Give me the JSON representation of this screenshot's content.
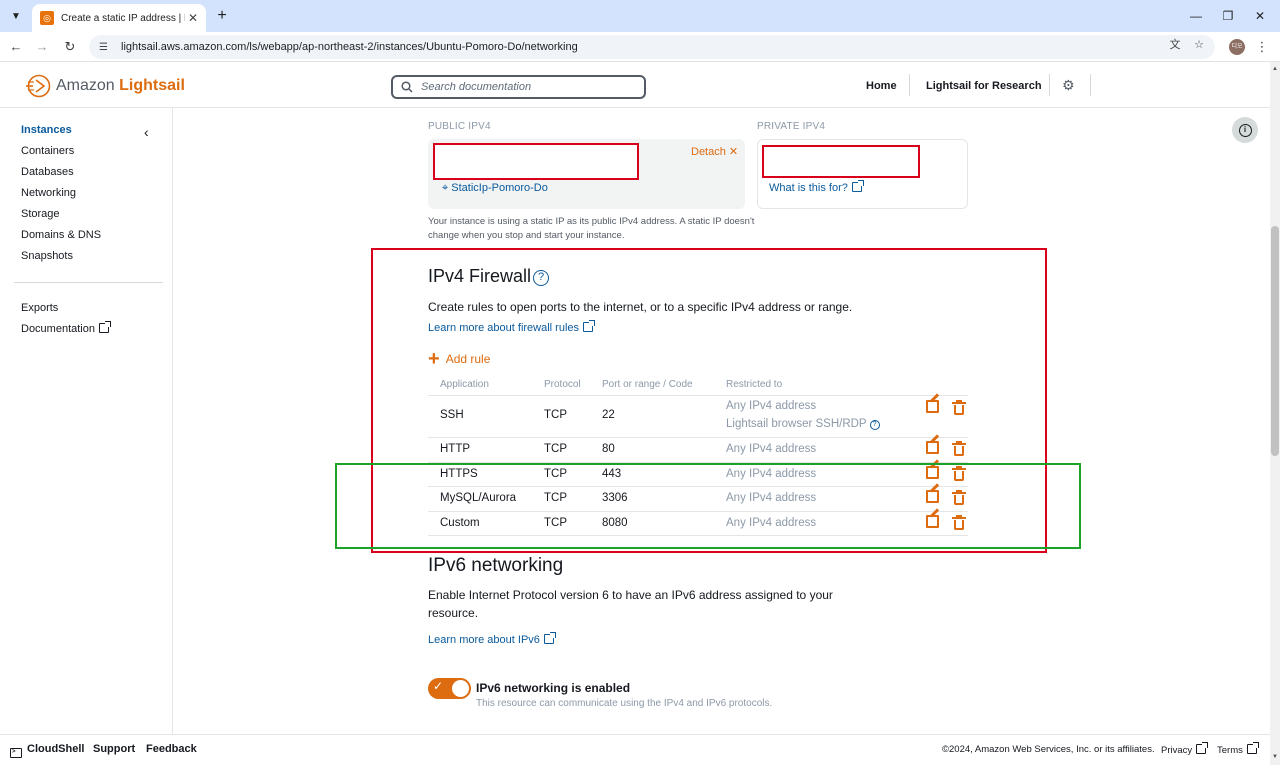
{
  "browser": {
    "tab_title": "Create a static IP address | Lig",
    "url": "lightsail.aws.amazon.com/ls/webapp/ap-northeast-2/instances/Ubuntu-Pomoro-Do/networking",
    "avatar_text": "디오"
  },
  "header": {
    "logo_prefix": "Amazon",
    "logo_brand": "Lightsail",
    "search_placeholder": "Search documentation",
    "home_label": "Home",
    "research_label": "Lightsail for Research"
  },
  "sidebar": {
    "items": [
      {
        "label": "Instances"
      },
      {
        "label": "Containers"
      },
      {
        "label": "Databases"
      },
      {
        "label": "Networking"
      },
      {
        "label": "Storage"
      },
      {
        "label": "Domains & DNS"
      },
      {
        "label": "Snapshots"
      }
    ],
    "exports_label": "Exports",
    "documentation_label": "Documentation"
  },
  "ip": {
    "public_label": "PUBLIC IPV4",
    "private_label": "PRIVATE IPV4",
    "detach_label": "Detach",
    "static_ip_name": "StaticIp-Pomoro-Do",
    "what_is_this": "What is this for?",
    "note": "Your instance is using a static IP as its public IPv4 address. A static IP doesn't change when you stop and start your instance."
  },
  "firewall": {
    "title": "IPv4 Firewall",
    "description": "Create rules to open ports to the internet, or to a specific IPv4 address or range.",
    "learn_more": "Learn more about firewall rules",
    "add_rule": "Add rule",
    "columns": [
      "Application",
      "Protocol",
      "Port or range / Code",
      "Restricted to"
    ],
    "rows": [
      {
        "application": "SSH",
        "protocol": "TCP",
        "port": "22",
        "restricted": "Any IPv4 address",
        "extra": "Lightsail browser SSH/RDP"
      },
      {
        "application": "HTTP",
        "protocol": "TCP",
        "port": "80",
        "restricted": "Any IPv4 address"
      },
      {
        "application": "HTTPS",
        "protocol": "TCP",
        "port": "443",
        "restricted": "Any IPv4 address"
      },
      {
        "application": "MySQL/Aurora",
        "protocol": "TCP",
        "port": "3306",
        "restricted": "Any IPv4 address"
      },
      {
        "application": "Custom",
        "protocol": "TCP",
        "port": "8080",
        "restricted": "Any IPv4 address"
      }
    ]
  },
  "ipv6": {
    "title": "IPv6 networking",
    "description": "Enable Internet Protocol version 6 to have an IPv6 address assigned to your resource.",
    "learn_more": "Learn more about IPv6",
    "toggle_label": "IPv6 networking is enabled",
    "toggle_sub": "This resource can communicate using the IPv4 and IPv6 protocols.",
    "enabled": true
  },
  "footer": {
    "cloudshell": "CloudShell",
    "support": "Support",
    "feedback": "Feedback",
    "copyright": "©2024, Amazon Web Services, Inc. or its affiliates.",
    "privacy": "Privacy",
    "terms": "Terms"
  },
  "colors": {
    "accent": "#dd6b10",
    "link": "#0a5a9c",
    "annotation_red": "#d9001b",
    "annotation_green": "#1aa22a"
  }
}
